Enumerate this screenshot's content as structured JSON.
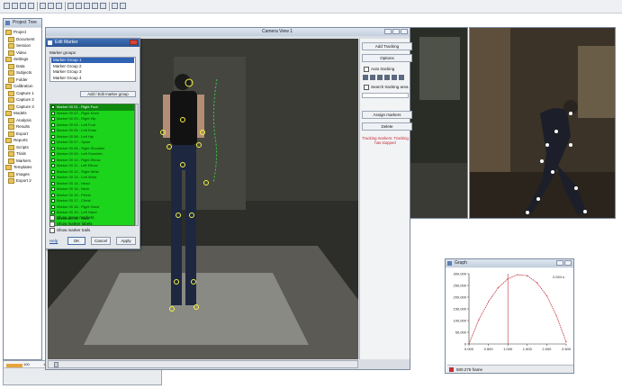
{
  "toolbar": {
    "icons": [
      "new-icon",
      "open-icon",
      "save-icon",
      "print-icon",
      "cut-icon",
      "copy-icon",
      "paste-icon",
      "camera-icon",
      "grid-icon",
      "table-icon",
      "window-icon",
      "graph-icon",
      "play-icon",
      "cursor-icon"
    ]
  },
  "explorer": {
    "title": "Project Tree",
    "items": [
      "Project",
      "Document",
      "Session",
      "Video",
      "Settings",
      "Data",
      "Subjects",
      "Folder",
      "Calibration",
      "Capture 1",
      "Capture 2",
      "Capture 3",
      "Models",
      "Analysis",
      "Results",
      "Export",
      "Reports",
      "Scripts",
      "Trials",
      "Markers",
      "Templates",
      "Images",
      "Export 2"
    ]
  },
  "video_window": {
    "title": "Camera View 1",
    "side_buttons": [
      "Add Tracking",
      "Options"
    ],
    "option_auto": "Auto tracking",
    "option_search": "Search tracking area",
    "side_buttons_2": [
      "Assign markers",
      "Delete"
    ],
    "status_red": "Tracking markers: Tracking has stopped"
  },
  "edit_dialog": {
    "title": "Edit Marker",
    "groups_label": "Marker groups",
    "groups": [
      "Marker Group 1",
      "Marker Group 2",
      "Marker Group 3",
      "Marker Group 4"
    ],
    "add_group_btn": "Add / Edit marker group",
    "markers": [
      "Marker 00 01 - Right Foot",
      "Marker 00 02 - Right Knee",
      "Marker 00 03 - Right Hip",
      "Marker 00 04 - Left Foot",
      "Marker 00 05 - Left Knee",
      "Marker 00 06 - Left Hip",
      "Marker 00 07 - Spine",
      "Marker 00 08 - Right Shoulder",
      "Marker 00 09 - Left Shoulder",
      "Marker 00 10 - Right Elbow",
      "Marker 00 11 - Left Elbow",
      "Marker 00 12 - Right Wrist",
      "Marker 00 13 - Left Wrist",
      "Marker 00 14 - Head",
      "Marker 00 15 - Neck",
      "Marker 00 16 - Pelvis",
      "Marker 00 17 - Chest",
      "Marker 00 18 - Right Hand",
      "Marker 00 19 - Left Hand",
      "Marker 00 20 - Back"
    ],
    "check_1": "Show group markers",
    "check_2": "Show marker labels",
    "check_3": "Show marker trails",
    "btn_help": "Help",
    "btn_ok": "OK",
    "btn_cancel": "Cancel",
    "btn_apply": "Apply"
  },
  "graph_window": {
    "title": "Graph",
    "readout": "2.034 s",
    "footer_value": "500.275",
    "footer_unit": "frame"
  },
  "timeline": {
    "ticks": [
      "100",
      "150",
      "200",
      "250",
      "300",
      "350",
      "400"
    ]
  },
  "chart_data": {
    "type": "line",
    "title": "",
    "xlabel": "",
    "ylabel": "",
    "x": [
      0,
      0.25,
      0.5,
      0.75,
      1.0,
      1.25,
      1.5,
      1.75,
      2.0,
      2.25,
      2.5
    ],
    "series": [
      {
        "values": [
          0,
          120000,
          210000,
          280000,
          325000,
          345000,
          340000,
          305000,
          240000,
          140000,
          10000
        ]
      }
    ],
    "ylim": [
      0,
      350000
    ],
    "ytick_labels": [
      "300,000",
      "250,000",
      "200,000",
      "150,000",
      "100,000",
      "50,000",
      "0"
    ],
    "xtick_labels": [
      "0.000",
      "0.500",
      "1.000",
      "1.500",
      "2.000",
      "2.500"
    ],
    "cursor_x": 1.0,
    "line_color": "#c0303a"
  }
}
